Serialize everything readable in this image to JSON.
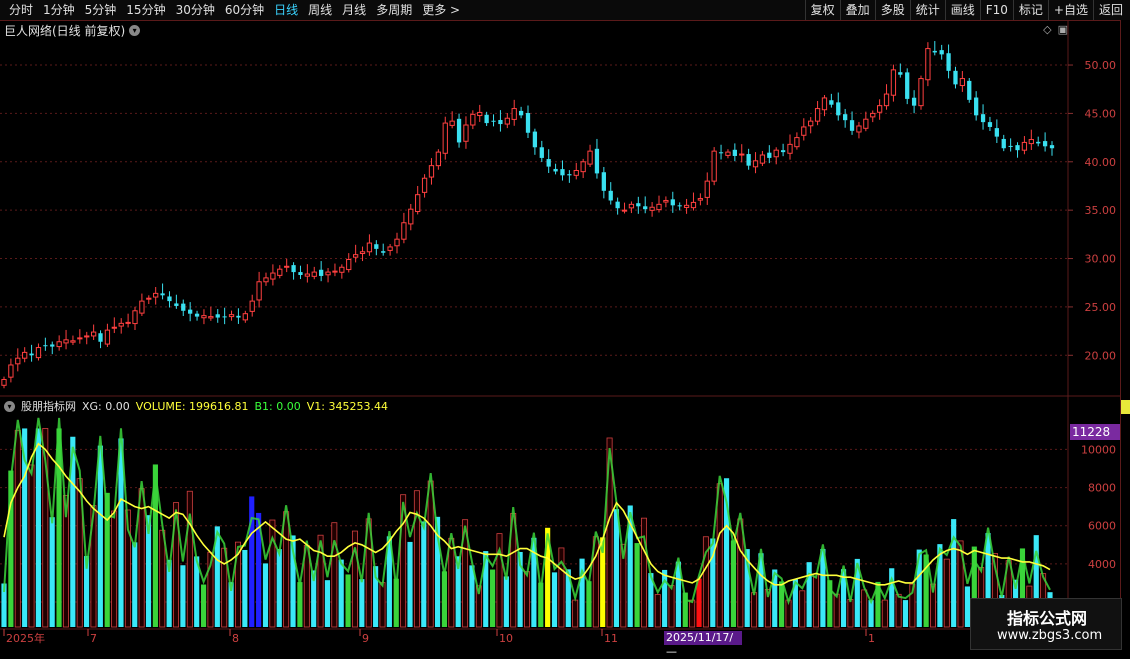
{
  "toolbar": {
    "left": [
      "分时",
      "1分钟",
      "5分钟",
      "15分钟",
      "30分钟",
      "60分钟",
      "日线",
      "周线",
      "月线",
      "多周期",
      "更多 >"
    ],
    "active": "日线",
    "right": [
      "复权",
      "叠加",
      "多股",
      "统计",
      "画线",
      "F10",
      "标记",
      "+自选",
      "返回"
    ]
  },
  "price_pane": {
    "title": "巨人网络(日线 前复权)",
    "y_ticks": [
      "50.00",
      "45.00",
      "40.00",
      "35.00",
      "30.00",
      "25.00",
      "20.00"
    ]
  },
  "indicator": {
    "name": "股朋指标网",
    "xg": "XG: 0.00",
    "volume": "VOLUME: 199616.81",
    "b1": "B1: 0.00",
    "v1": "V1: 345253.44",
    "y_ticks": [
      "10000",
      "8000",
      "6000",
      "4000",
      "2000"
    ],
    "badge": "11228"
  },
  "x_axis": {
    "labels": [
      "2025年",
      "7",
      "8",
      "9",
      "10",
      "11",
      "1"
    ],
    "date_badge": "2025/11/17/—"
  },
  "watermark": {
    "title": "指标公式网",
    "url": "www.zbgs3.com"
  },
  "colors": {
    "up": "#ff4040",
    "down": "#3ae0f0",
    "ma": "#ffff3a",
    "grid": "#5a1a1a",
    "green": "#3ad43a"
  },
  "chart_data": {
    "type": "candlestick+volume",
    "price_range": [
      16,
      53
    ],
    "volume_range": [
      2000,
      11228
    ],
    "ohlc_close": [
      17.5,
      19.0,
      19.7,
      20.3,
      20.0,
      20.8,
      21.0,
      20.9,
      21.4,
      21.6,
      21.5,
      21.8,
      22.0,
      22.4,
      21.4,
      22.6,
      22.9,
      23.3,
      23.4,
      24.6,
      25.6,
      25.9,
      26.4,
      26.2,
      25.6,
      25.1,
      24.6,
      24.3,
      24.0,
      24.1,
      24.0,
      23.9,
      24.0,
      24.2,
      23.9,
      24.3,
      25.6,
      27.6,
      28.0,
      28.5,
      28.9,
      29.2,
      28.6,
      28.3,
      28.4,
      28.6,
      28.2,
      28.6,
      28.7,
      29.1,
      29.9,
      30.4,
      30.7,
      31.6,
      31.0,
      30.6,
      31.2,
      32.0,
      33.7,
      35.1,
      36.6,
      38.3,
      39.6,
      41.0,
      44.0,
      44.2,
      42.0,
      43.8,
      44.9,
      45.1,
      44.0,
      44.2,
      43.9,
      44.5,
      45.5,
      44.8,
      43.0,
      41.5,
      40.4,
      39.5,
      39.0,
      38.6,
      38.6,
      39.1,
      40.0,
      41.1,
      38.8,
      37.0,
      36.0,
      35.2,
      35.0,
      35.6,
      35.4,
      35.1,
      35.3,
      35.6,
      36.0,
      35.5,
      35.4,
      35.5,
      35.8,
      36.2,
      38.0,
      41.1,
      40.9,
      41.0,
      40.6,
      40.8,
      39.6,
      40.1,
      40.7,
      40.4,
      41.2,
      41.0,
      41.8,
      42.5,
      43.6,
      44.2,
      45.5,
      46.6,
      45.9,
      44.8,
      44.3,
      43.2,
      43.7,
      44.4,
      45.0,
      45.8,
      47.0,
      49.5,
      49.0,
      46.5,
      45.8,
      48.6,
      51.7,
      51.3,
      51.1,
      49.4,
      48.0,
      48.6,
      46.4,
      44.8,
      44.1,
      43.6,
      42.6,
      41.4,
      41.6,
      41.2,
      42.0,
      42.3,
      41.9,
      41.6,
      41.4
    ],
    "volume_ma": [
      5400,
      7200,
      8000,
      8600,
      9600,
      10300,
      10000,
      9500,
      9100,
      8600,
      8200,
      7800,
      7300,
      6900,
      6600,
      6300,
      6700,
      7400,
      7200,
      7000,
      6900,
      7000,
      6800,
      6600,
      6400,
      6700,
      6600,
      6100,
      5500,
      5000,
      4600,
      4200,
      4000,
      4200,
      4500,
      5100,
      5600,
      5900,
      6200,
      5900,
      5600,
      5300,
      5200,
      5300,
      5000,
      4700,
      4600,
      4400,
      4400,
      4600,
      4900,
      5100,
      5000,
      4800,
      4600,
      4800,
      5200,
      5700,
      6100,
      6700,
      6600,
      6400,
      6000,
      5500,
      5200,
      4800,
      4900,
      4800,
      4700,
      4600,
      4500,
      4500,
      4500,
      4400,
      4600,
      4800,
      4800,
      4600,
      4400,
      4300,
      4000,
      3700,
      3400,
      3200,
      3300,
      3800,
      4400,
      5300,
      6400,
      7200,
      6800,
      6100,
      5400,
      4700,
      4000,
      3600,
      3400,
      3300,
      3200,
      3100,
      3000,
      3200,
      3800,
      4400,
      5600,
      6000,
      5600,
      4700,
      4200,
      3800,
      3400,
      3100,
      2900,
      2900,
      3100,
      3200,
      3300,
      3400,
      3500,
      3400,
      3400,
      3400,
      3300,
      3300,
      3200,
      3100,
      3000,
      2900,
      2900,
      3000,
      3100,
      3000,
      3000,
      3400,
      3800,
      4200,
      4500,
      4700,
      4800,
      4700,
      4500,
      4700,
      4600,
      4500,
      4400,
      4300,
      4300,
      4200,
      4100,
      4100,
      4000,
      3900,
      3700
    ]
  }
}
